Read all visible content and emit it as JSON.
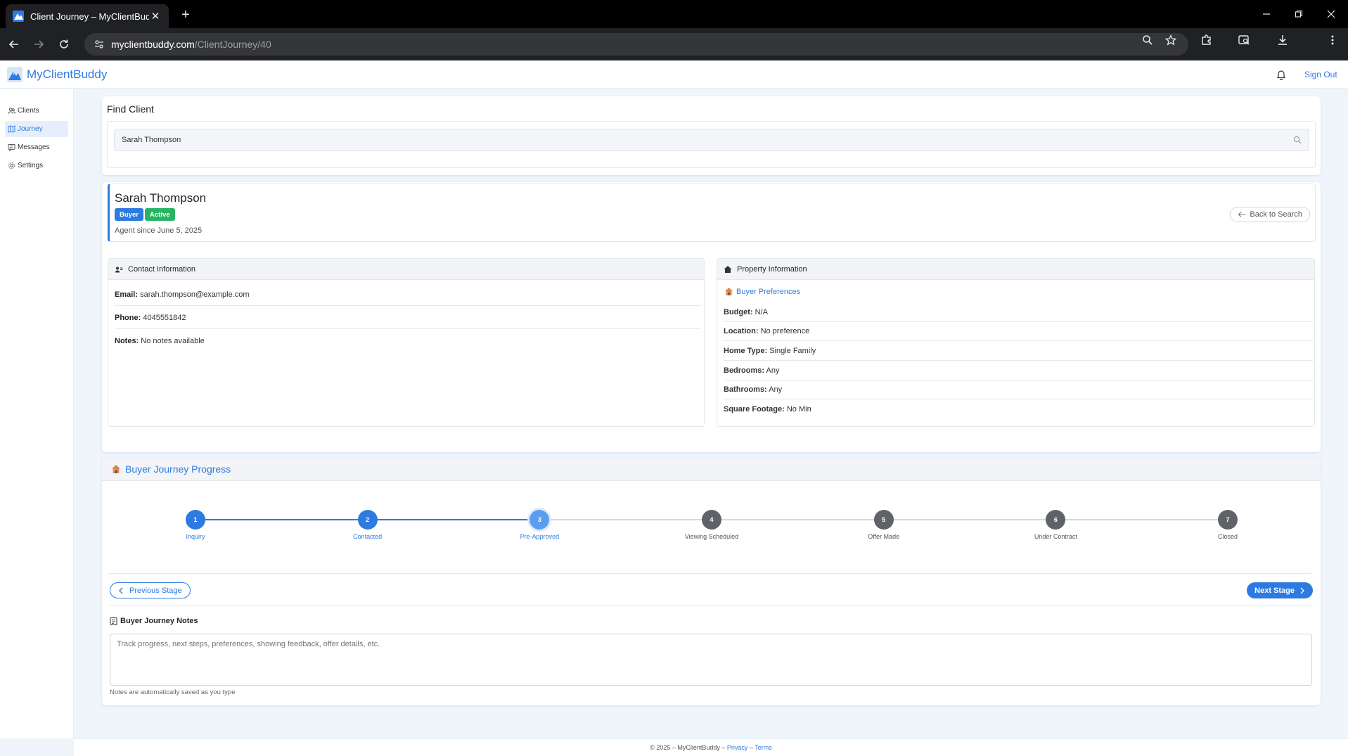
{
  "browser": {
    "tab_title": "Client Journey – MyClientBuddy",
    "url_domain": "myclientbuddy.com",
    "url_path": "/ClientJourney/40"
  },
  "header": {
    "brand": "MyClientBuddy",
    "sign_out": "Sign Out"
  },
  "sidebar": {
    "items": [
      {
        "label": "Clients",
        "icon": "clients-icon"
      },
      {
        "label": "Journey",
        "icon": "journey-icon"
      },
      {
        "label": "Messages",
        "icon": "messages-icon"
      },
      {
        "label": "Settings",
        "icon": "settings-icon"
      }
    ],
    "active": "Journey"
  },
  "find": {
    "title": "Find Client",
    "value": "Sarah Thompson"
  },
  "client": {
    "name": "Sarah Thompson",
    "badges": [
      "Buyer",
      "Active"
    ],
    "agent_since": "Agent since June 5, 2025",
    "back_label": "Back to Search"
  },
  "contact": {
    "title": "Contact Information",
    "email_label": "Email:",
    "email": "sarah.thompson@example.com",
    "phone_label": "Phone:",
    "phone": "4045551842",
    "notes_label": "Notes:",
    "notes": "No notes available"
  },
  "property": {
    "title": "Property Information",
    "pref_title": "Buyer Preferences",
    "rows": [
      {
        "label": "Budget:",
        "value": "N/A"
      },
      {
        "label": "Location:",
        "value": "No preference"
      },
      {
        "label": "Home Type:",
        "value": "Single Family"
      },
      {
        "label": "Bedrooms:",
        "value": "Any"
      },
      {
        "label": "Bathrooms:",
        "value": "Any"
      },
      {
        "label": "Square Footage:",
        "value": "No Min"
      }
    ]
  },
  "journey": {
    "title": "Buyer Journey Progress",
    "current_stage": 3,
    "stages": [
      {
        "num": "1",
        "label": "Inquiry"
      },
      {
        "num": "2",
        "label": "Contacted"
      },
      {
        "num": "3",
        "label": "Pre-Approved"
      },
      {
        "num": "4",
        "label": "Viewing Scheduled"
      },
      {
        "num": "5",
        "label": "Offer Made"
      },
      {
        "num": "6",
        "label": "Under Contract"
      },
      {
        "num": "7",
        "label": "Closed"
      }
    ],
    "prev_label": "Previous Stage",
    "next_label": "Next Stage",
    "notes_title": "Buyer Journey Notes",
    "notes_placeholder": "Track progress, next steps, preferences, showing feedback, offer details, etc.",
    "notes_help": "Notes are automatically saved as you type"
  },
  "footer": {
    "copyright": "© 2025 – MyClientBuddy –",
    "privacy": "Privacy",
    "sep": "–",
    "terms": "Terms"
  },
  "colors": {
    "accent": "#2d7be0",
    "current_stage": "#5a9ef0",
    "pending_stage": "#5f6368",
    "buyer_badge": "#2d7be0",
    "active_badge": "#28b463"
  }
}
